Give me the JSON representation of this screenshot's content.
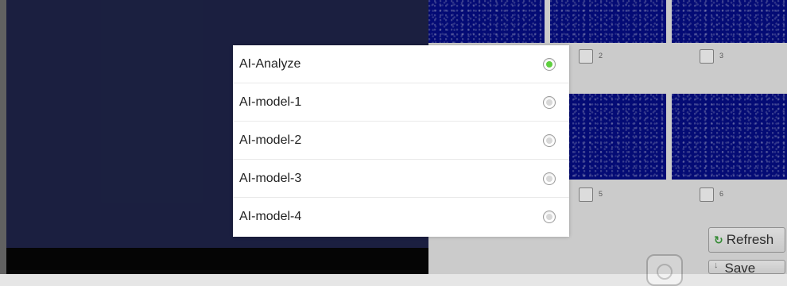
{
  "gallery": {
    "tile_numbers": [
      "2",
      "3",
      "5",
      "6"
    ],
    "refresh_label": "Refresh",
    "save_label": "Save",
    "thumb_color": "#050d86"
  },
  "model_dialog": {
    "selected_index": 0,
    "accent_color": "#5fcf3f",
    "options": [
      {
        "label": "AI-Analyze",
        "checked": true
      },
      {
        "label": "AI-model-1",
        "checked": false
      },
      {
        "label": "AI-model-2",
        "checked": false
      },
      {
        "label": "AI-model-3",
        "checked": false
      },
      {
        "label": "AI-model-4",
        "checked": false
      }
    ]
  }
}
